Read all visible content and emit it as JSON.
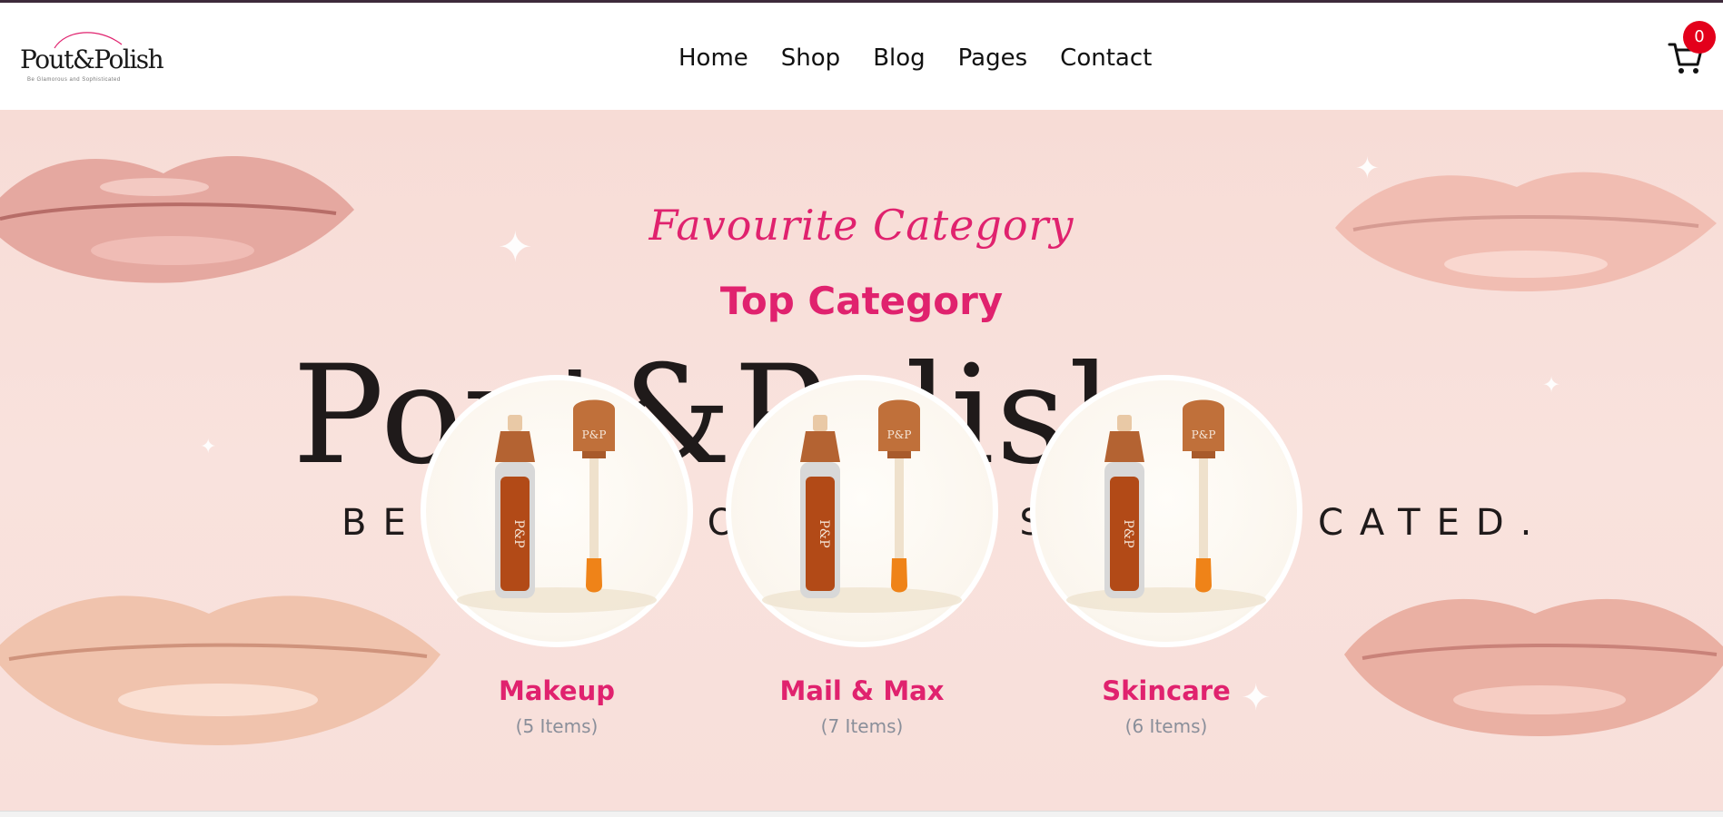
{
  "logo": {
    "text_left": "Pout",
    "text_amp": "&",
    "text_right": "Polish",
    "tagline": "Be Glamorous and Sophisticated"
  },
  "nav": {
    "items": [
      "Home",
      "Shop",
      "Blog",
      "Pages",
      "Contact"
    ]
  },
  "cart": {
    "count": "0",
    "icon": "cart-icon"
  },
  "hero": {
    "script_title": "Favourite Category",
    "title": "Top Category",
    "background_brand": "Pout&Polish",
    "background_tagline": "BE GLAMOROUS AND SOPHISTICATED."
  },
  "categories": [
    {
      "name": "Makeup",
      "count": "(5 Items)"
    },
    {
      "name": "Mail & Max",
      "count": "(7 Items)"
    },
    {
      "name": "Skincare",
      "count": "(6 Items)"
    }
  ],
  "product_monogram": "P&P",
  "colors": {
    "accent": "#e0226e",
    "badge": "#e3001b",
    "muted": "#8a8f9a",
    "hero_bg": "#f9e2dd"
  }
}
